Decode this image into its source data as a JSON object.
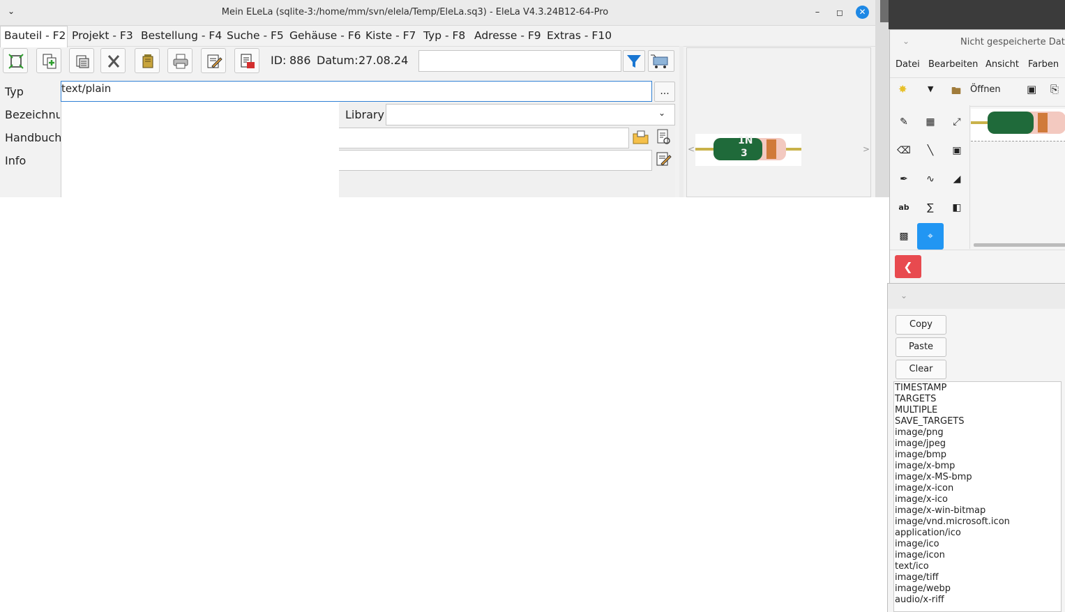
{
  "window": {
    "title": "Mein ELeLa (sqlite-3:/home/mm/svn/elela/Temp/EleLa.sq3) - EleLa V4.3.24B12-64-Pro"
  },
  "menu": [
    "Bauteil - F2",
    "Projekt - F3",
    "Bestellung - F4",
    "Suche - F5",
    "Gehäuse - F6",
    "Kiste - F7",
    "Typ - F8",
    "Adresse - F9",
    "Extras - F10"
  ],
  "toolbar": {
    "id_label": "ID:",
    "id_value": "886",
    "date_label": "Datum:",
    "date_value": "27.08.24",
    "search_value": ""
  },
  "form": {
    "labels": [
      "Typ",
      "Bezeichnur",
      "Handbuch",
      "Info"
    ],
    "typ_value": "text/plain",
    "dots_label": "...",
    "library_label": "Library",
    "library_value": ""
  },
  "preview": {
    "left_arrow": "<",
    "right_arrow": ">",
    "part_marking": [
      "1N",
      "3"
    ]
  },
  "paint": {
    "title": "Nicht gespeicherte Date",
    "menu": [
      "Datei",
      "Bearbeiten",
      "Ansicht",
      "Farben"
    ],
    "open_label": "Öffnen",
    "accent": "#2196f3",
    "back_color": "#e84a4f"
  },
  "clipboard": {
    "buttons": [
      "Copy",
      "Paste",
      "Clear"
    ],
    "targets": [
      "TIMESTAMP",
      "TARGETS",
      "MULTIPLE",
      "SAVE_TARGETS",
      "image/png",
      "image/jpeg",
      "image/bmp",
      "image/x-bmp",
      "image/x-MS-bmp",
      "image/x-icon",
      "image/x-ico",
      "image/x-win-bitmap",
      "image/vnd.microsoft.icon",
      "application/ico",
      "image/ico",
      "image/icon",
      "text/ico",
      "image/tiff",
      "image/webp",
      "audio/x-riff"
    ]
  },
  "colors": {
    "close_button": "#1e88e5",
    "filter_icon": "#1976d2"
  }
}
